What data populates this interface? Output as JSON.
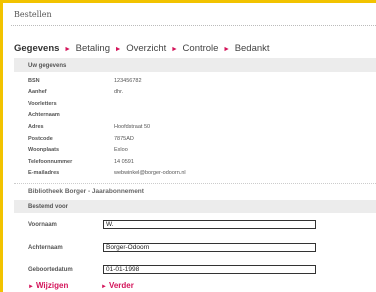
{
  "header": {
    "title": "Bestellen"
  },
  "steps": [
    {
      "label": "Gegevens"
    },
    {
      "label": "Betaling"
    },
    {
      "label": "Overzicht"
    },
    {
      "label": "Controle"
    },
    {
      "label": "Bedankt"
    }
  ],
  "step_arrow": "►",
  "section1": {
    "title": "Uw gegevens",
    "rows": [
      {
        "label": "BSN",
        "value": "123456782"
      },
      {
        "label": "Aanhef",
        "value": "dhr."
      },
      {
        "label": "Voorletters",
        "value": ""
      },
      {
        "label": "Achternaam",
        "value": ""
      },
      {
        "label": "Adres",
        "value": "Hoofdstraat 50"
      },
      {
        "label": "Postcode",
        "value": "7875AD"
      },
      {
        "label": "Woonplaats",
        "value": "Exloo"
      },
      {
        "label": "Telefoonnummer",
        "value": "14 0591"
      },
      {
        "label": "E-mailadres",
        "value": "webwinkel@borger-odoorn.nl"
      }
    ]
  },
  "section2": {
    "heading": "Bibliotheek Borger - Jaarabonnement",
    "band_title": "Bestemd voor",
    "fields": {
      "voornaam": {
        "label": "Voornaam",
        "value": "W."
      },
      "achternaam": {
        "label": "Achternaam",
        "value": "Borger-Odoorn"
      },
      "geboortedatum": {
        "label": "Geboortedatum",
        "value": "01-01-1998"
      }
    }
  },
  "actions": {
    "arrow": "►",
    "wijzigen": "Wijzigen",
    "verder": "Verder"
  }
}
